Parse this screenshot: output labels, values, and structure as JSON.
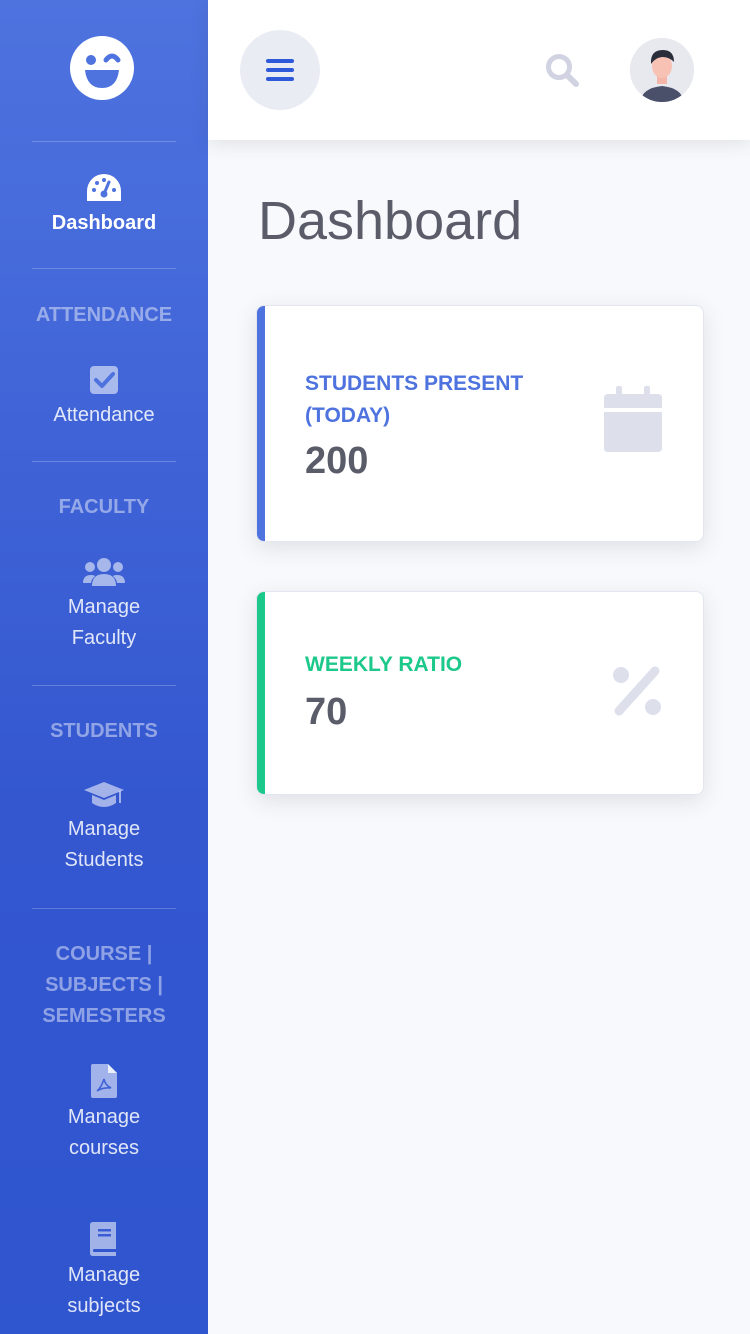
{
  "sidebar": {
    "brand_icon": "laugh-wink-icon",
    "items": [
      {
        "label": "Dashboard",
        "icon": "tachometer-icon",
        "active": true
      },
      {
        "heading": "ATTENDANCE"
      },
      {
        "label": "Attendance",
        "icon": "check-square-icon"
      },
      {
        "heading": "FACULTY"
      },
      {
        "label": "Manage Faculty",
        "icon": "users-icon"
      },
      {
        "heading": "STUDENTS"
      },
      {
        "label": "Manage Students",
        "icon": "graduation-cap-icon"
      },
      {
        "heading": "COURSE | SUBJECTS | SEMESTERS"
      },
      {
        "label": "Manage courses",
        "icon": "file-pdf-icon"
      },
      {
        "label": "Manage subjects",
        "icon": "book-icon"
      }
    ]
  },
  "topbar": {
    "menu_icon": "bars-icon",
    "search_icon": "search-icon",
    "avatar_icon": "user-avatar"
  },
  "page": {
    "title": "Dashboard"
  },
  "cards": [
    {
      "label": "STUDENTS PRESENT (TODAY)",
      "value": "200",
      "icon": "calendar-icon",
      "accent": "#4e73df"
    },
    {
      "label": "WEEKLY RATIO",
      "value": "70",
      "icon": "percent-icon",
      "accent": "#1cc88a"
    }
  ],
  "colors": {
    "primary": "#4e73df",
    "success": "#1cc88a",
    "text": "#5a5c69",
    "icon_muted": "#dddfeb"
  }
}
